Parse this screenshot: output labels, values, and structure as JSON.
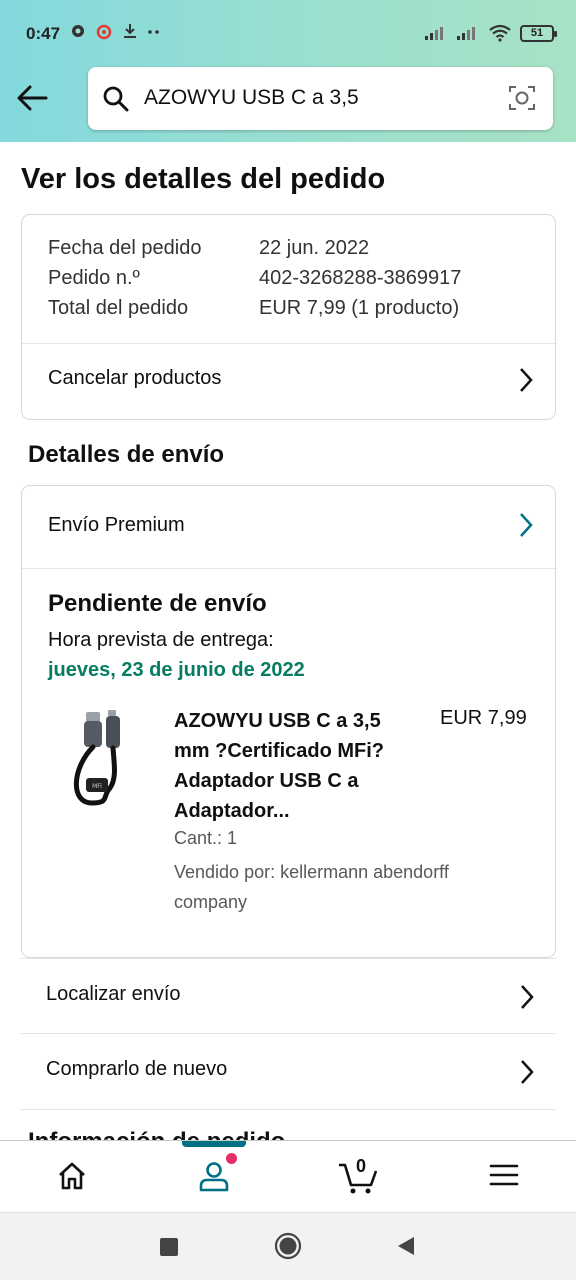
{
  "status_bar": {
    "time": "0:47",
    "battery": "51"
  },
  "search": {
    "query": "AZOWYU USB C a 3,5"
  },
  "page": {
    "title": "Ver los detalles del pedido"
  },
  "order_summary": {
    "rows": [
      {
        "label": "Fecha del pedido",
        "value": "22 jun. 2022"
      },
      {
        "label": "Pedido n.º",
        "value": "402-3268288-3869917"
      },
      {
        "label": "Total del pedido",
        "value": "EUR 7,99 (1 producto)"
      }
    ],
    "cancel_label": "Cancelar productos"
  },
  "shipping": {
    "section_title": "Detalles de envío",
    "method_label": "Envío Premium",
    "status": "Pendiente de envío",
    "eta_label": "Hora prevista de entrega:",
    "eta_date": "jueves, 23 de junio de 2022",
    "product": {
      "title": "AZOWYU USB C a 3,5 mm ?Certificado MFi? Adaptador USB C a Adaptador...",
      "price": "EUR 7,99",
      "quantity": "Cant.: 1",
      "seller": "Vendido por: kellermann abendorff company"
    }
  },
  "actions": {
    "track_label": "Localizar envío",
    "buy_again_label": "Comprarlo de nuevo",
    "partial_heading": "Información de pedido"
  },
  "bottom_nav": {
    "items": [
      "home-icon",
      "account-icon",
      "cart-icon",
      "menu-icon"
    ],
    "cart_count": "0",
    "active_color": "#007185"
  },
  "colors": {
    "eta_green": "#067d62",
    "accent_teal": "#007185",
    "badge_pink": "#e52e63"
  }
}
